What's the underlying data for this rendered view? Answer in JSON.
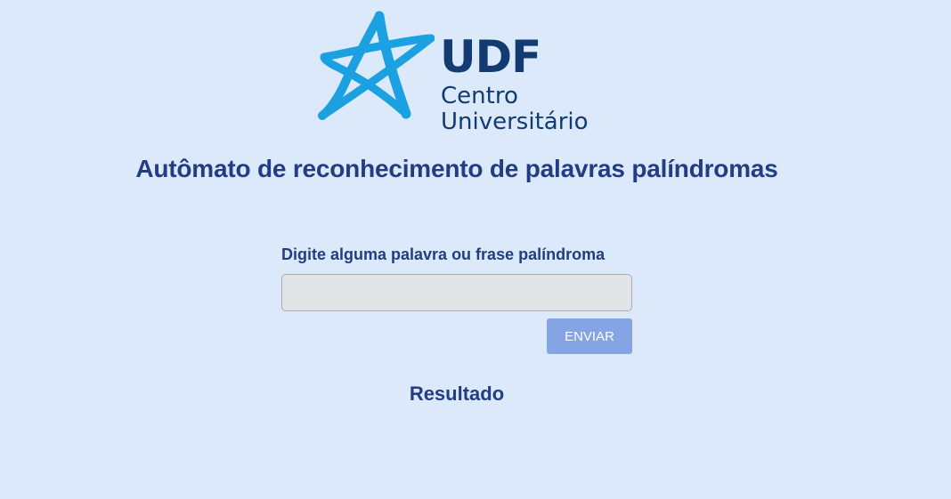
{
  "logo": {
    "brand": "UDF",
    "line1": "Centro",
    "line2": "Universitário",
    "icon": "star-icon",
    "colors": {
      "star": "#1ba1e2",
      "text": "#123b72"
    }
  },
  "header": {
    "title": "Autômato de reconhecimento de palavras palíndromas"
  },
  "form": {
    "label": "Digite alguma palavra ou frase palíndroma",
    "input_value": "",
    "button_label": "ENVIAR"
  },
  "result": {
    "heading": "Resultado"
  },
  "colors": {
    "background": "#dbe9fb",
    "heading": "#223d83",
    "button": "#85a4e4",
    "input_bg": "#e3e4e7"
  }
}
